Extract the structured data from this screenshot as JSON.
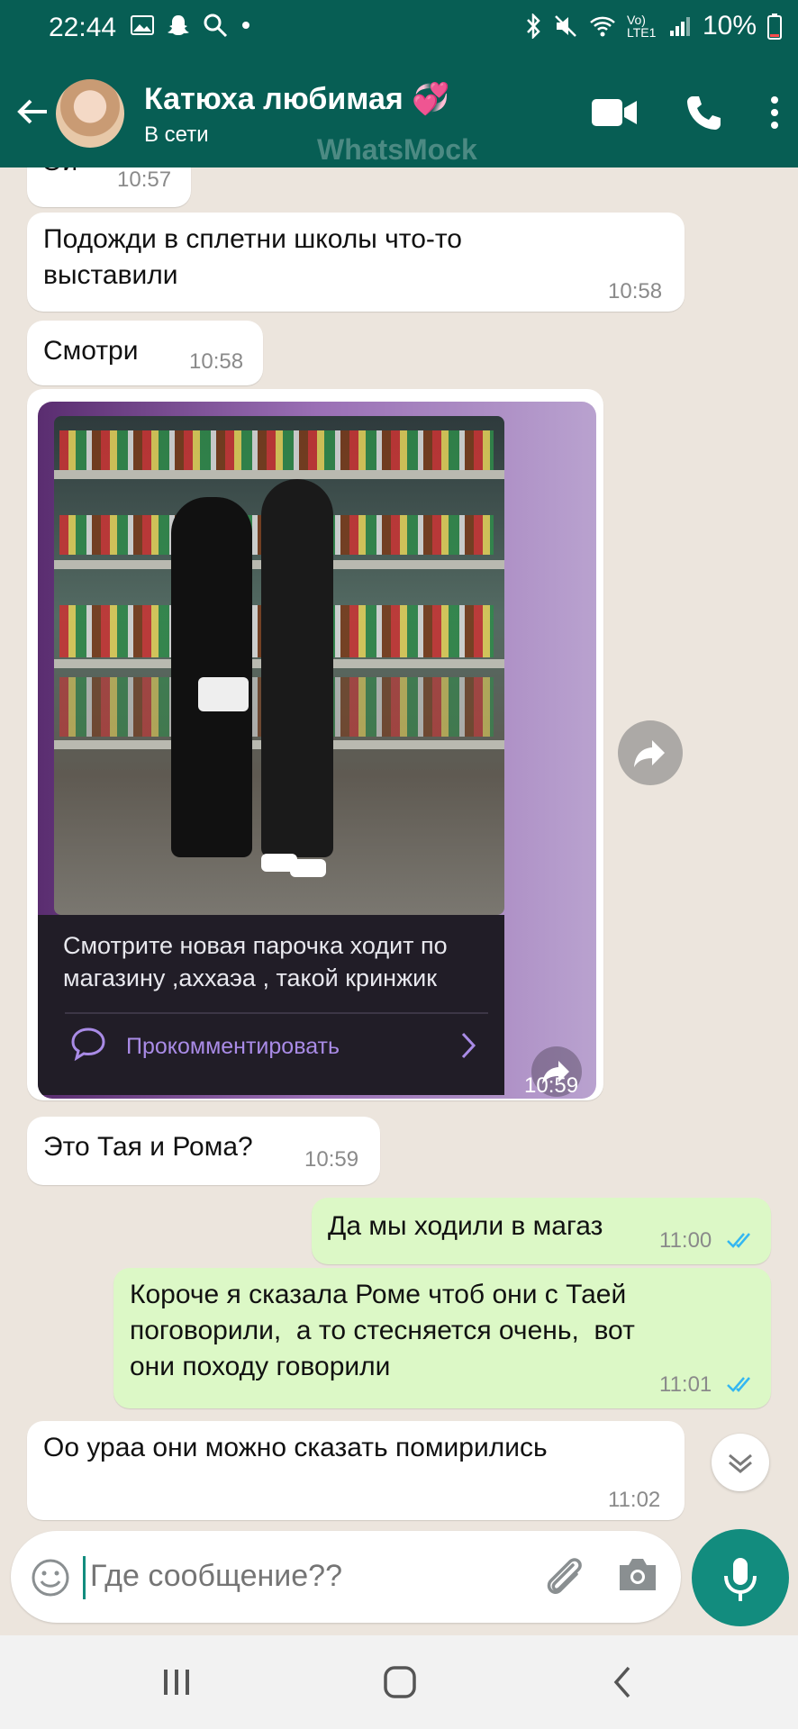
{
  "status_bar": {
    "time": "22:44",
    "battery": "10%",
    "network": "Vo) LTE1"
  },
  "header": {
    "contact_name": "Катюха любимая 💞",
    "status": "В сети",
    "watermark": "WhatsMock"
  },
  "messages": [
    {
      "text": "Ой",
      "time": "10:57",
      "dir": "in"
    },
    {
      "text": "Подожди в сплетни школы что-то\nвыставили",
      "time": "10:58",
      "dir": "in"
    },
    {
      "text": "Смотри",
      "time": "10:58",
      "dir": "in"
    },
    {
      "text": "Это Тая и Рома?",
      "time": "10:59",
      "dir": "in"
    },
    {
      "text": "Да мы ходили в магаз",
      "time": "11:00",
      "dir": "out"
    },
    {
      "text": "Короче я сказала Роме чтоб они с Таей\nпоговорили,  а то стесняется очень,  вот\nони походу говорили",
      "time": "11:01",
      "dir": "out"
    },
    {
      "text": "Оо ураа они можно сказать помирились",
      "time": "11:02",
      "dir": "in"
    }
  ],
  "media_message": {
    "caption": "Смотрите новая парочка ходит по магазину ,аххаэа , такой кринжик",
    "comment_label": "Прокомментировать",
    "time": "10:59"
  },
  "input": {
    "placeholder": "Где сообщение??"
  },
  "icons": {
    "back": "arrow-left",
    "video": "video-camera",
    "call": "phone",
    "menu": "three-dots",
    "emoji": "smiley",
    "attach": "paperclip",
    "camera": "camera",
    "mic": "microphone",
    "forward": "share-arrow",
    "scroll": "double-chevron-down"
  },
  "colors": {
    "header": "#075e54",
    "accent": "#128c7e",
    "outgoing": "#dcf8c6",
    "incoming": "#ffffff",
    "read_ticks": "#34b7f1"
  }
}
